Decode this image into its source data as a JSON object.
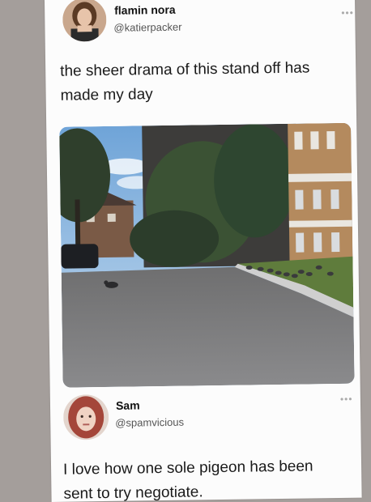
{
  "tweet": {
    "author_name": "flamin nora",
    "author_handle": "@katierpacker",
    "more_icon": "ellipsis-icon",
    "text_line1": "the sheer drama of this stand off has",
    "text_line2": "made my day",
    "photo_icon": "photo-pigeon-standoff"
  },
  "reply": {
    "author_name": "Sam",
    "author_handle": "@spamvicious",
    "more_icon": "ellipsis-icon",
    "text_line1": "I love how one sole pigeon has been",
    "text_line2": "sent to try negotiate."
  },
  "colors": {
    "background": "#a49e9b",
    "card": "#fcfcfc"
  }
}
